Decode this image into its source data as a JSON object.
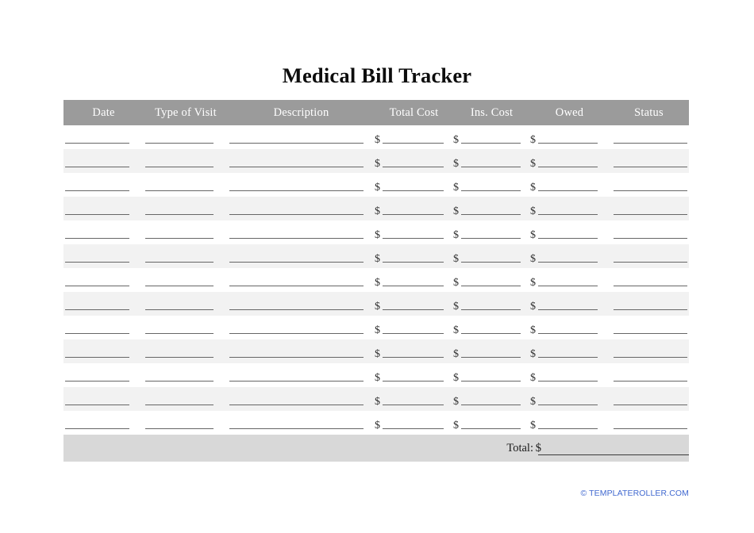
{
  "document": {
    "title": "Medical Bill Tracker"
  },
  "table": {
    "columns": [
      {
        "key": "date",
        "label": "Date",
        "type": "line"
      },
      {
        "key": "type_visit",
        "label": "Type of Visit",
        "type": "line"
      },
      {
        "key": "description",
        "label": "Description",
        "type": "line"
      },
      {
        "key": "total_cost",
        "label": "Total Cost",
        "type": "currency",
        "prefix": "$"
      },
      {
        "key": "ins_cost",
        "label": "Ins. Cost",
        "type": "currency",
        "prefix": "$"
      },
      {
        "key": "owed",
        "label": "Owed",
        "type": "currency",
        "prefix": "$"
      },
      {
        "key": "status",
        "label": "Status",
        "type": "line"
      }
    ],
    "row_count": 13,
    "rows": [
      {
        "date": "",
        "type_visit": "",
        "description": "",
        "total_cost": "",
        "ins_cost": "",
        "owed": "",
        "status": ""
      },
      {
        "date": "",
        "type_visit": "",
        "description": "",
        "total_cost": "",
        "ins_cost": "",
        "owed": "",
        "status": ""
      },
      {
        "date": "",
        "type_visit": "",
        "description": "",
        "total_cost": "",
        "ins_cost": "",
        "owed": "",
        "status": ""
      },
      {
        "date": "",
        "type_visit": "",
        "description": "",
        "total_cost": "",
        "ins_cost": "",
        "owed": "",
        "status": ""
      },
      {
        "date": "",
        "type_visit": "",
        "description": "",
        "total_cost": "",
        "ins_cost": "",
        "owed": "",
        "status": ""
      },
      {
        "date": "",
        "type_visit": "",
        "description": "",
        "total_cost": "",
        "ins_cost": "",
        "owed": "",
        "status": ""
      },
      {
        "date": "",
        "type_visit": "",
        "description": "",
        "total_cost": "",
        "ins_cost": "",
        "owed": "",
        "status": ""
      },
      {
        "date": "",
        "type_visit": "",
        "description": "",
        "total_cost": "",
        "ins_cost": "",
        "owed": "",
        "status": ""
      },
      {
        "date": "",
        "type_visit": "",
        "description": "",
        "total_cost": "",
        "ins_cost": "",
        "owed": "",
        "status": ""
      },
      {
        "date": "",
        "type_visit": "",
        "description": "",
        "total_cost": "",
        "ins_cost": "",
        "owed": "",
        "status": ""
      },
      {
        "date": "",
        "type_visit": "",
        "description": "",
        "total_cost": "",
        "ins_cost": "",
        "owed": "",
        "status": ""
      },
      {
        "date": "",
        "type_visit": "",
        "description": "",
        "total_cost": "",
        "ins_cost": "",
        "owed": "",
        "status": ""
      },
      {
        "date": "",
        "type_visit": "",
        "description": "",
        "total_cost": "",
        "ins_cost": "",
        "owed": "",
        "status": ""
      }
    ]
  },
  "footer": {
    "total_label": "Total:",
    "total_prefix": "$",
    "total_value": ""
  },
  "watermark": {
    "text": "© TEMPLATEROLLER.COM"
  },
  "colors": {
    "header_band": "#9b9b9b",
    "row_shade": "#f2f2f2",
    "row_plain": "#ffffff",
    "total_band": "#d8d8d8",
    "rule": "#666666",
    "watermark": "#4169d0",
    "title": "#0d0d0d"
  }
}
